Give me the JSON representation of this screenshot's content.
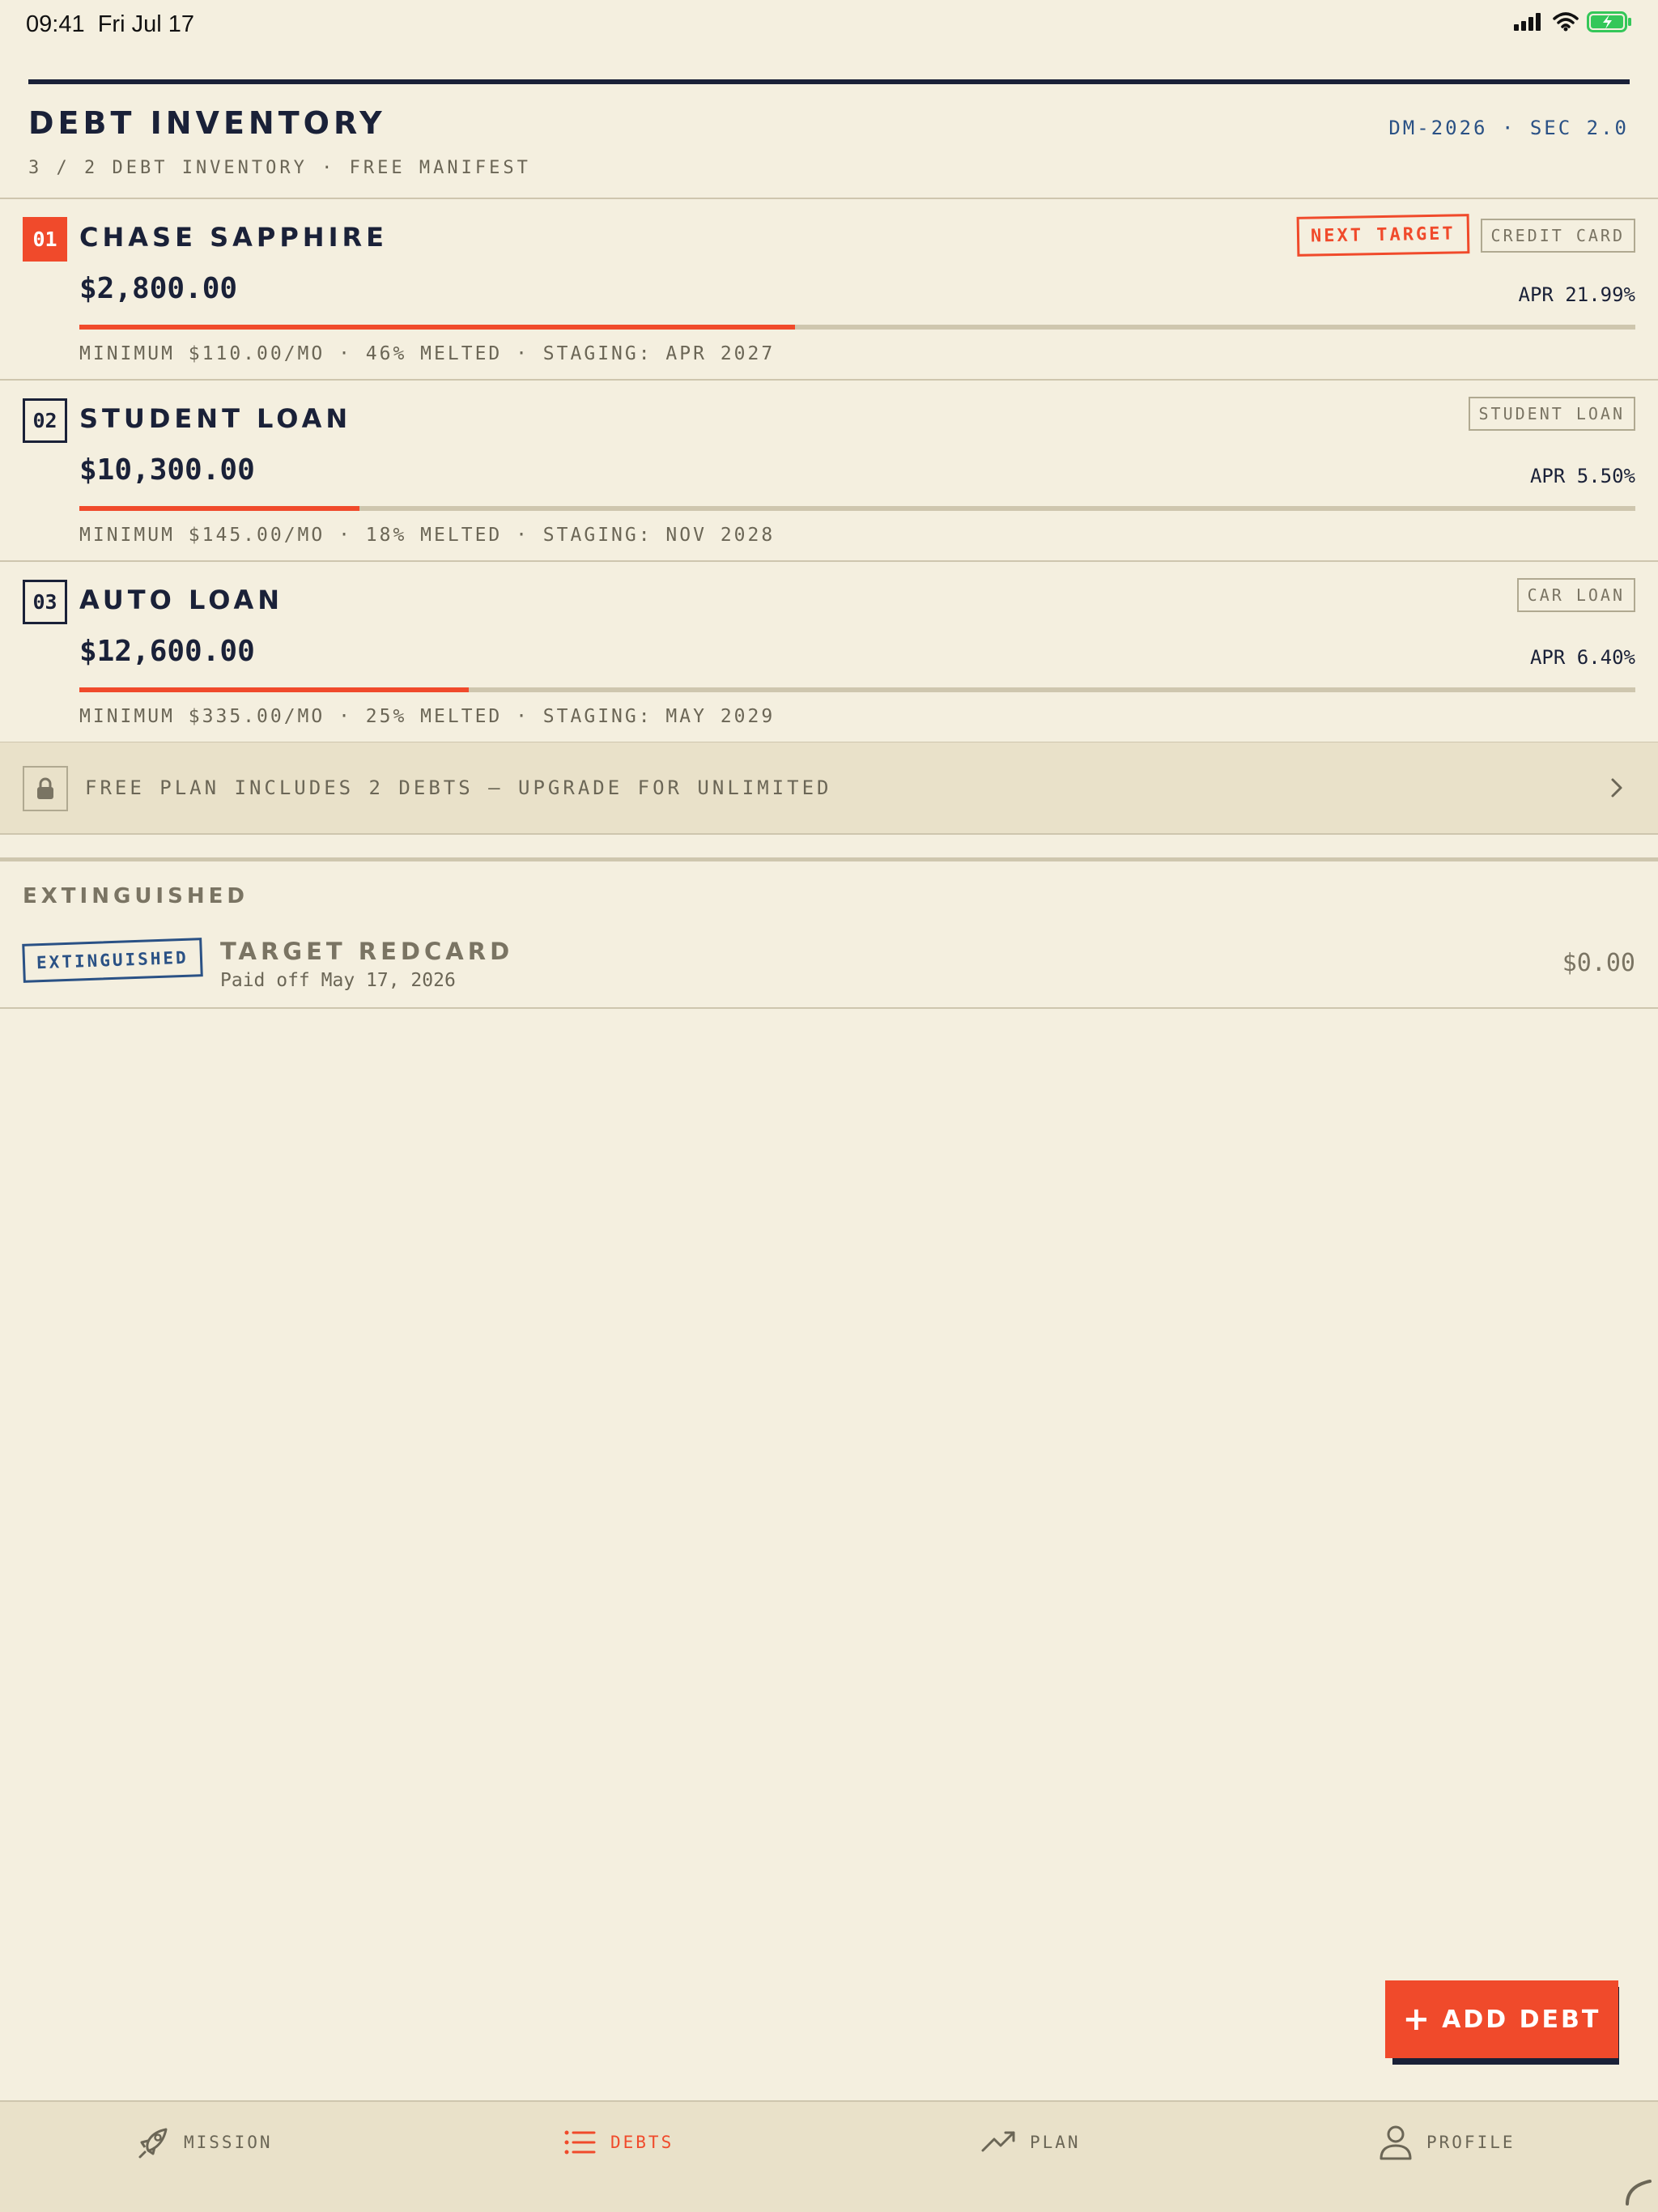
{
  "status_bar": {
    "time": "09:41",
    "date": "Fri Jul 17",
    "icons": [
      "cellular-signal",
      "wifi",
      "battery-charging"
    ],
    "battery_color": "#34C759"
  },
  "header": {
    "title": "DEBT INVENTORY",
    "doc_code": "DM-2026 · SEC 2.0",
    "subtitle": "3 / 2 DEBT INVENTORY · FREE MANIFEST"
  },
  "colors": {
    "background": "#F4EFDF",
    "ink": "#1A2138",
    "accent": "#F04A2B",
    "stamp_blue": "#2A5185",
    "muted": "#6B6656"
  },
  "debts": [
    {
      "number": "01",
      "name": "CHASE SAPPHIRE",
      "badge": "NEXT TARGET",
      "type": "CREDIT CARD",
      "balance": "$2,800.00",
      "apr": "APR 21.99%",
      "melted_fraction": 0.46,
      "meta": "MINIMUM $110.00/MO · 46% MELTED · STAGING: APR 2027"
    },
    {
      "number": "02",
      "name": "STUDENT LOAN",
      "type": "STUDENT LOAN",
      "balance": "$10,300.00",
      "apr": "APR 5.50%",
      "melted_fraction": 0.18,
      "meta": "MINIMUM $145.00/MO · 18% MELTED · STAGING: NOV 2028"
    },
    {
      "number": "03",
      "name": "AUTO LOAN",
      "type": "CAR LOAN",
      "balance": "$12,600.00",
      "apr": "APR 6.40%",
      "melted_fraction": 0.25,
      "meta": "MINIMUM $335.00/MO · 25% MELTED · STAGING: MAY 2029"
    }
  ],
  "upgrade": {
    "icon": "lock-icon",
    "text": "FREE PLAN INCLUDES 2 DEBTS — UPGRADE FOR UNLIMITED"
  },
  "extinguished": {
    "heading": "EXTINGUISHED",
    "items": [
      {
        "stamp": "EXTINGUISHED",
        "name": "TARGET REDCARD",
        "paid_off": "Paid off May 17, 2026",
        "amount": "$0.00"
      }
    ]
  },
  "add_button": {
    "plus": "+",
    "label": "ADD DEBT"
  },
  "tabs": [
    {
      "label": "MISSION",
      "icon": "rocket-icon",
      "active": false
    },
    {
      "label": "DEBTS",
      "icon": "list-icon",
      "active": true
    },
    {
      "label": "PLAN",
      "icon": "trend-up-icon",
      "active": false
    },
    {
      "label": "PROFILE",
      "icon": "person-icon",
      "active": false
    }
  ]
}
